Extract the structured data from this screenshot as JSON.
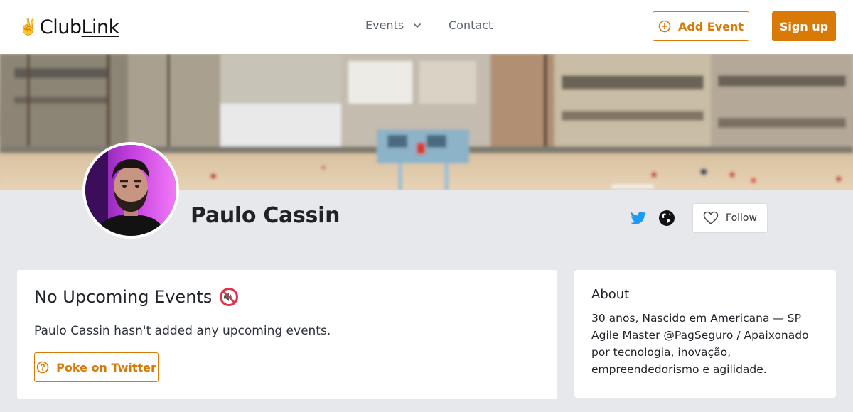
{
  "header": {
    "logo_emoji": "✌️",
    "logo_word1": "Club",
    "logo_word2": "Link",
    "nav": {
      "events_label": "Events",
      "contact_label": "Contact"
    },
    "add_event_label": "Add Event",
    "signup_label": "Sign up"
  },
  "profile": {
    "name": "Paulo Cassin",
    "follow_label": "Follow",
    "social_icons": [
      "twitter-icon",
      "globe-icon"
    ]
  },
  "events_card": {
    "title": "No Upcoming Events",
    "description": "Paulo Cassin hasn't added any upcoming events.",
    "poke_label": "Poke on Twitter"
  },
  "about_card": {
    "title": "About",
    "text": "30 anos, Nascido em Americana — SP Agile Master @PagSeguro / Apaixonado por tecnologia, inovação, empreendedorismo e agilidade."
  },
  "colors": {
    "accent": "#d97a06",
    "twitter": "#1d9bf0",
    "page_bg": "#e6e8ec"
  }
}
